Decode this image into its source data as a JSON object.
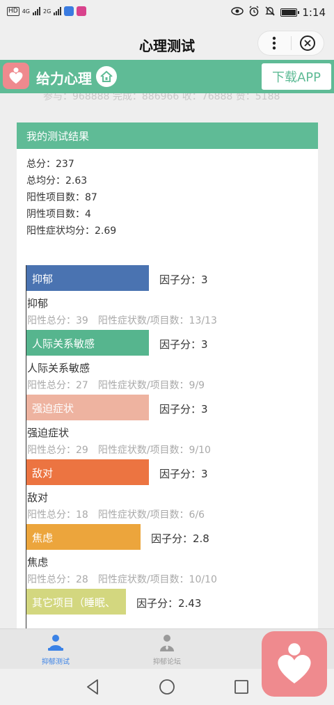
{
  "statusbar": {
    "hd": "HD",
    "net1": "4G",
    "net2": "2G",
    "time": "1:14"
  },
  "titlebar": {
    "title": "心理测试"
  },
  "banner": {
    "name": "给力心理",
    "download": "下载APP"
  },
  "peek_text": "参与：968888 完成：886966 收：76888 赞：5188",
  "card": {
    "title": "我的测试结果",
    "summary": [
      "总分：237",
      "总均分：2.63",
      "阳性项目数：87",
      "阴性项目数：4",
      "阳性症状均分：2.69"
    ]
  },
  "chart_data": {
    "type": "bar",
    "orientation": "horizontal",
    "categories": [
      "抑郁",
      "人际关系敏感",
      "强迫症状",
      "敌对",
      "焦虑",
      "其它项目（睡眠、饮食）"
    ],
    "values": [
      3,
      3,
      3,
      3,
      2.8,
      2.43
    ],
    "value_prefix": "因子分：",
    "colors": [
      "#4a73b1",
      "#56b58e",
      "#eeb3a0",
      "#ec7441",
      "#eca53c",
      "#d3d77f"
    ],
    "factors": [
      {
        "name": "抑郁",
        "bar_label": "抑郁",
        "score": "因子分：3",
        "value": 3,
        "stats": "阳性总分：39　阳性症状数/项目数：13/13",
        "color": "#4a73b1"
      },
      {
        "name": "人际关系敏感",
        "bar_label": "人际关系敏感",
        "score": "因子分：3",
        "value": 3,
        "stats": "阳性总分：27　阳性症状数/项目数：9/9",
        "color": "#56b58e"
      },
      {
        "name": "强迫症状",
        "bar_label": "强迫症状",
        "score": "因子分：3",
        "value": 3,
        "stats": "阳性总分：29　阳性症状数/项目数：9/10",
        "color": "#eeb3a0"
      },
      {
        "name": "敌对",
        "bar_label": "敌对",
        "score": "因子分：3",
        "value": 3,
        "stats": "阳性总分：18　阳性症状数/项目数：6/6",
        "color": "#ec7441"
      },
      {
        "name": "焦虑",
        "bar_label": "焦虑",
        "score": "因子分：2.8",
        "value": 2.8,
        "stats": "阳性总分：28　阳性症状数/项目数：10/10",
        "color": "#eca53c"
      },
      {
        "name": "",
        "bar_label": "其它项目（睡眠、",
        "score": "因子分：2.43",
        "value": 2.43,
        "stats": "",
        "color": "#d3d77f"
      }
    ],
    "xlim": [
      0,
      3
    ]
  },
  "tabs": [
    {
      "label": "抑郁测试",
      "active": true,
      "color": "#3b82e6"
    },
    {
      "label": "抑郁论坛",
      "active": false,
      "color": "#9a9a9a"
    }
  ],
  "icons": {
    "banner_logo": "heart-person-icon",
    "home": "home-icon",
    "fab": "heart-person-icon"
  },
  "colors": {
    "brand_green": "#5fbb96",
    "brand_pink": "#ef8a8e",
    "tab_active": "#3b82e6"
  }
}
